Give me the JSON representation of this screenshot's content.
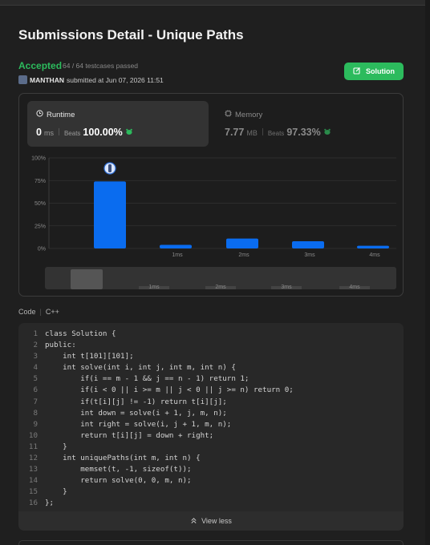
{
  "page": {
    "title": "Submissions Detail - Unique Paths"
  },
  "status": {
    "label": "Accepted",
    "testcases": "64 / 64 testcases passed",
    "color": "#2cbb5d"
  },
  "submitter": {
    "name": "MANTHAN",
    "submitted_text": "submitted at Jun 07, 2026 11:51"
  },
  "solution_button": {
    "label": "Solution"
  },
  "runtime": {
    "label": "Runtime",
    "value": "0",
    "unit": "ms",
    "beats_label": "Beats",
    "beats_value": "100.00%"
  },
  "memory": {
    "label": "Memory",
    "value": "7.77",
    "unit": "MB",
    "beats_label": "Beats",
    "beats_value": "97.33%"
  },
  "chart_data": {
    "type": "bar",
    "categories": [
      "0ms",
      "1ms",
      "2ms",
      "3ms",
      "4ms"
    ],
    "x_tick_labels": [
      "",
      "1ms",
      "2ms",
      "3ms",
      "4ms"
    ],
    "values": [
      74,
      4,
      11,
      8,
      3
    ],
    "y_ticks": [
      "100%",
      "75%",
      "50%",
      "25%",
      "0%"
    ],
    "ylim": [
      0,
      100
    ],
    "bar_color": "#0a6cef",
    "grid": true
  },
  "navigator": {
    "labels": [
      "1ms",
      "2ms",
      "3ms",
      "4ms"
    ]
  },
  "code": {
    "header_label": "Code",
    "language": "C++",
    "lines": [
      "class Solution {",
      "public:",
      "    int t[101][101];",
      "    int solve(int i, int j, int m, int n) {",
      "        if(i == m - 1 && j == n - 1) return 1;",
      "        if(i < 0 || i >= m || j < 0 || j >= n) return 0;",
      "        if(t[i][j] != -1) return t[i][j];",
      "        int down = solve(i + 1, j, m, n);",
      "        int right = solve(i, j + 1, m, n);",
      "        return t[i][j] = down + right;",
      "    }",
      "    int uniquePaths(int m, int n) {",
      "        memset(t, -1, sizeof(t));",
      "        return solve(0, 0, m, n);",
      "    }",
      "};"
    ],
    "line_numbers": [
      "1",
      "2",
      "3",
      "4",
      "5",
      "6",
      "7",
      "8",
      "9",
      "10",
      "11",
      "12",
      "13",
      "14",
      "15",
      "16"
    ]
  },
  "view_less": {
    "label": "View less"
  }
}
